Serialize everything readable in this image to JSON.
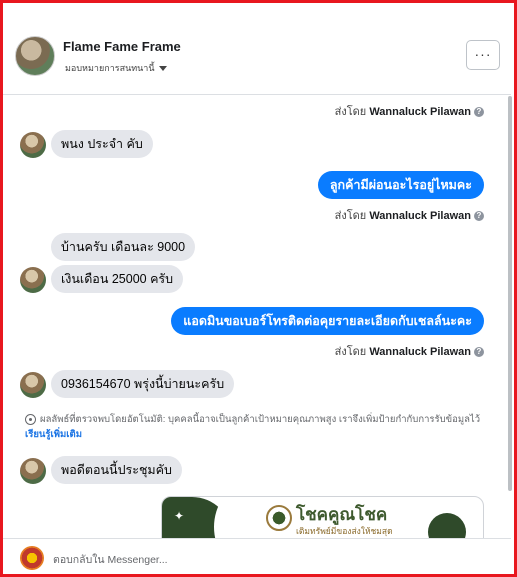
{
  "header": {
    "contact_name": "Flame Fame Frame",
    "assign_label": "มอบหมายการสนทนานี้",
    "more_label": "···"
  },
  "sent_by": {
    "prefix": "ส่งโดย",
    "agent": "Wannaluck Pilawan",
    "help": "?"
  },
  "messages": [
    {
      "side": "in",
      "text": "พนง ประจำ คับ"
    },
    {
      "side": "out",
      "text": "ลูกค้ามีผ่อนอะไรอยู่ไหมคะ"
    },
    {
      "side": "in",
      "text": "บ้านครับ เดือนละ 9000"
    },
    {
      "side": "in",
      "text": "เงินเดือน 25000 ครับ"
    },
    {
      "side": "out",
      "text": "แอดมินขอเบอร์โทรติดต่อคุยรายละเอียดกับเชลล์นะคะ"
    },
    {
      "side": "in",
      "text": "0936154670 พรุ่งนี้บ่ายนะครับ"
    },
    {
      "side": "in",
      "text": "พอดีตอนนี้ประชุมคับ"
    }
  ],
  "auto_note": {
    "text": "ผลลัพธ์ที่ตรวจพบโดยอัตโนมัติ: บุคคลนี้อาจเป็นลูกค้าเป้าหมายคุณภาพสูง เราจึงเพิ่มป้ายกำกับการรับข้อมูลไว้",
    "learn_more": "เรียนรู้เพิ่มเติม"
  },
  "card": {
    "brand": "โชคคูณโชค",
    "tagline": "เติมทรัพย์มีของส่งให้ชมสุด",
    "star": "✦"
  },
  "composer": {
    "placeholder": "ตอบกลับใน Messenger..."
  },
  "colors": {
    "outgoing_bubble": "#0a7cff",
    "incoming_bubble": "#e4e6eb",
    "frame": "#e8171f",
    "brand_green": "#2f4a2a"
  }
}
